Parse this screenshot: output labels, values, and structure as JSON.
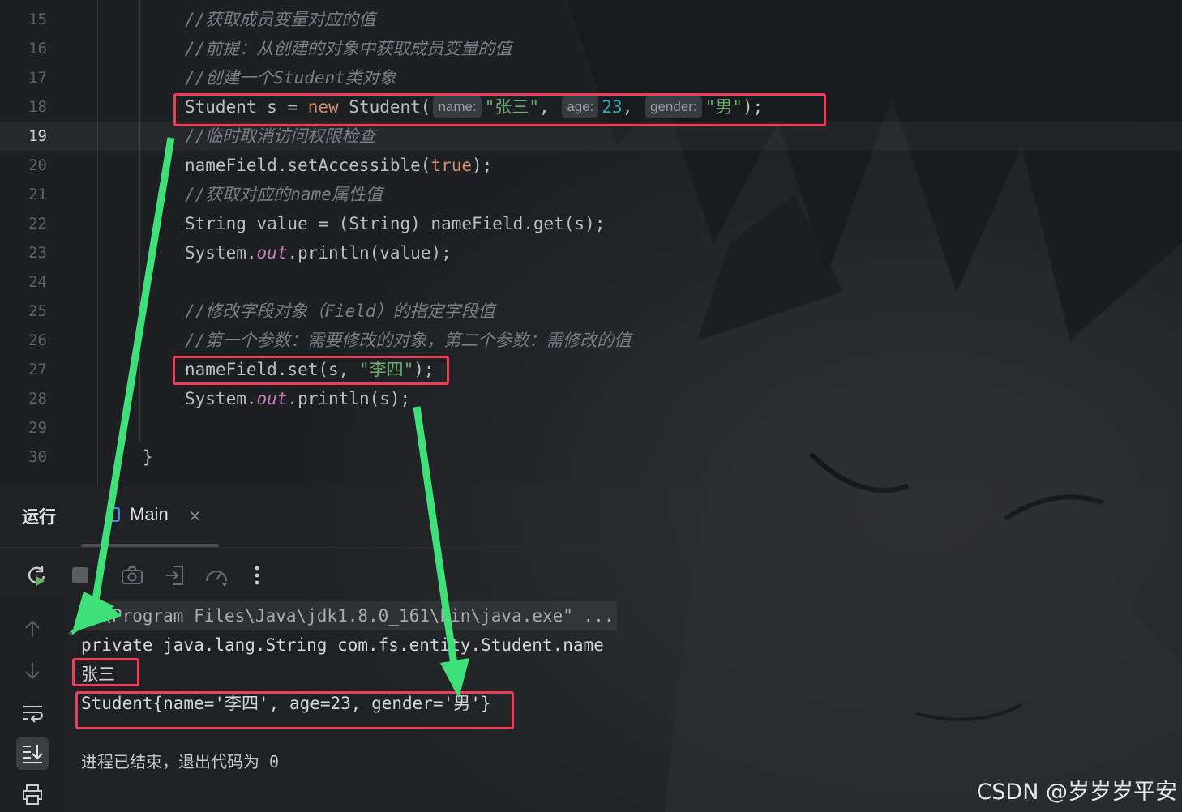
{
  "editor": {
    "current_line": "19",
    "lines": [
      {
        "num": "15",
        "text": "//获取成员变量对应的值"
      },
      {
        "num": "16",
        "text": "//前提：从创建的对象中获取成员变量的值"
      },
      {
        "num": "17",
        "text": "//创建一个Student类对象"
      },
      {
        "num": "18",
        "prefix": "Student s = ",
        "kw": "new",
        "ctor": " Student(",
        "hint_name": "name:",
        "arg_name": "\"张三\"",
        "sep1": ",",
        "hint_age": "age:",
        "arg_age": "23",
        "sep2": ",",
        "hint_gender": "gender:",
        "arg_gender": "\"男\"",
        "end": ");"
      },
      {
        "num": "19",
        "text": "//临时取消访问权限检查"
      },
      {
        "num": "20",
        "prefix": "nameField.setAccessible(",
        "kw": "true",
        "end": ");"
      },
      {
        "num": "21",
        "text": "//获取对应的name属性值"
      },
      {
        "num": "22",
        "text": "String value = (String) nameField.get(s);"
      },
      {
        "num": "23",
        "prefix": "System.",
        "field": "out",
        "end": ".println(value);"
      },
      {
        "num": "24",
        "text": ""
      },
      {
        "num": "25",
        "text": "//修改字段对象（Field）的指定字段值"
      },
      {
        "num": "26",
        "text": "//第一个参数：需要修改的对象，第二个参数：需修改的值"
      },
      {
        "num": "27",
        "prefix": "nameField.set(s, ",
        "str": "\"李四\"",
        "end": ");"
      },
      {
        "num": "28",
        "prefix": "System.",
        "field": "out",
        "end": ".println(s);"
      },
      {
        "num": "29",
        "text": ""
      },
      {
        "num": "30",
        "text": "}"
      }
    ]
  },
  "run_panel": {
    "title": "运行",
    "tab_label": "Main",
    "tab_close": "×",
    "toolbar_icons": [
      "rerun-icon",
      "stop-icon",
      "camera-icon",
      "exit-icon",
      "speedometer-icon",
      "more-icon"
    ],
    "sidebar_icons": [
      "arrow-up-icon",
      "arrow-down-icon",
      "soft-wrap-icon",
      "scroll-to-end-icon",
      "print-icon"
    ]
  },
  "console": {
    "lines": [
      "C:\\Program Files\\Java\\jdk1.8.0_161\\bin\\java.exe\" ...",
      "private java.lang.String com.fs.entity.Student.name",
      "张三",
      "Student{name='李四', age=23, gender='男'}",
      "进程已结束，退出代码为 0"
    ]
  },
  "watermark": "CSDN @岁岁岁平安",
  "colors": {
    "highlight_box": "#f03c5a",
    "arrow": "#3ee07a",
    "keyword": "#cf8e6d",
    "string": "#6aab73",
    "number": "#2aacb8",
    "static_field": "#c77dbb",
    "comment": "#7a7e85"
  }
}
